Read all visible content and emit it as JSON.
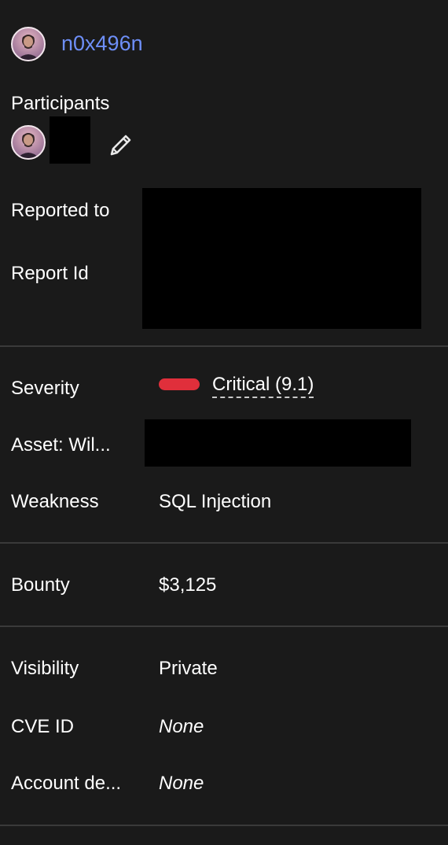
{
  "reporter": {
    "username": "n0x496n"
  },
  "participants": {
    "label": "Participants"
  },
  "fields": {
    "reported_to": "Reported to",
    "report_id": "Report Id",
    "severity": {
      "label": "Severity",
      "value": "Critical (9.1)",
      "color": "#e02f3b"
    },
    "asset": {
      "label": "Asset: Wil..."
    },
    "weakness": {
      "label": "Weakness",
      "value": "SQL Injection"
    },
    "bounty": {
      "label": "Bounty",
      "value": "$3,125"
    },
    "visibility": {
      "label": "Visibility",
      "value": "Private"
    },
    "cve_id": {
      "label": "CVE ID",
      "value": "None"
    },
    "account_details": {
      "label": "Account de...",
      "value": "None"
    }
  },
  "colors": {
    "background": "#1a1a1a",
    "link": "#6e8ff8",
    "divider": "#3a3a3a"
  },
  "icons": {
    "edit": "pencil-icon"
  }
}
